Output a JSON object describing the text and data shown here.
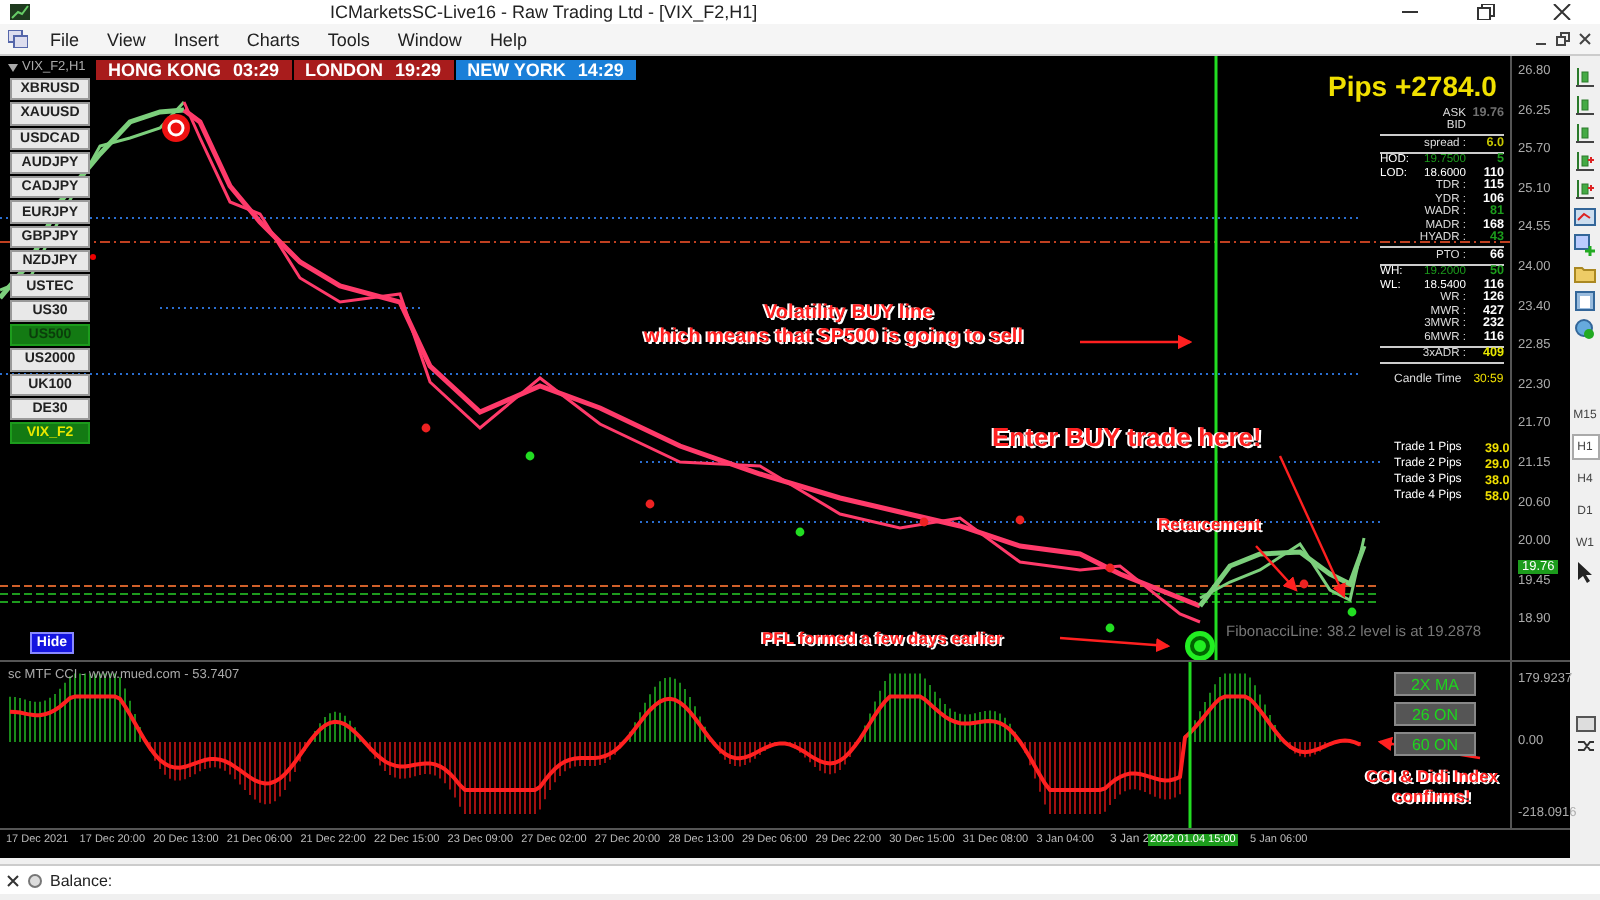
{
  "window": {
    "title": "ICMarketsSC-Live16 - Raw Trading Ltd - [VIX_F2,H1]"
  },
  "menu": [
    "File",
    "View",
    "Insert",
    "Charts",
    "Tools",
    "Window",
    "Help"
  ],
  "chart": {
    "tab": "VIX_F2,H1",
    "sessions": [
      {
        "name": "HONG KONG",
        "time": "03:29",
        "color": "#a81c1c"
      },
      {
        "name": "LONDON",
        "time": "19:29",
        "color": "#a81c1c"
      },
      {
        "name": "NEW YORK",
        "time": "14:29",
        "color": "#1a7fd8"
      }
    ],
    "symbols": [
      {
        "label": "XBRUSD",
        "selected": false,
        "current": false,
        "alert": false
      },
      {
        "label": "XAUUSD",
        "selected": false,
        "current": false,
        "alert": false
      },
      {
        "label": "USDCAD",
        "selected": false,
        "current": false,
        "alert": false
      },
      {
        "label": "AUDJPY",
        "selected": false,
        "current": false,
        "alert": false
      },
      {
        "label": "CADJPY",
        "selected": false,
        "current": false,
        "alert": false
      },
      {
        "label": "EURJPY",
        "selected": false,
        "current": false,
        "alert": false
      },
      {
        "label": "GBPJPY",
        "selected": false,
        "current": false,
        "alert": false
      },
      {
        "label": "NZDJPY",
        "selected": false,
        "current": false,
        "alert": true
      },
      {
        "label": "USTEC",
        "selected": false,
        "current": false,
        "alert": false
      },
      {
        "label": "US30",
        "selected": false,
        "current": false,
        "alert": false
      },
      {
        "label": "US500",
        "selected": true,
        "current": false,
        "alert": false
      },
      {
        "label": "US2000",
        "selected": false,
        "current": false,
        "alert": false
      },
      {
        "label": "UK100",
        "selected": false,
        "current": false,
        "alert": false
      },
      {
        "label": "DE30",
        "selected": false,
        "current": false,
        "alert": false
      },
      {
        "label": "VIX_F2",
        "selected": true,
        "current": true,
        "alert": false
      }
    ],
    "hide_button": "Hide",
    "pips": "Pips +2784.0",
    "stats_groups": [
      [
        {
          "label": "ASK",
          "value": "19.76",
          "color": "#707070"
        },
        {
          "label": "BID"
        }
      ],
      [
        {
          "label": "spread :",
          "value": "6.0",
          "color": "#c8c800"
        }
      ],
      [
        {
          "label": "HOD:",
          "detail": "19.7500",
          "value": "5",
          "color": "#1c9c1c"
        },
        {
          "label": "LOD:",
          "detail": "18.6000",
          "value": "110",
          "color": "#ffffff"
        },
        {
          "label": "TDR :",
          "value": "115",
          "color": "#ffffff"
        },
        {
          "label": "YDR :",
          "value": "106",
          "color": "#ffffff"
        },
        {
          "label": "WADR :",
          "value": "81",
          "color": "#1c9c1c"
        },
        {
          "label": "MADR :",
          "value": "168",
          "color": "#ffffff"
        },
        {
          "label": "HYADR :",
          "value": "43",
          "color": "#1c9c1c"
        }
      ],
      [
        {
          "label": "PTO :",
          "value": "66",
          "color": "#ffffff"
        }
      ],
      [
        {
          "label": "WH:",
          "detail": "19.2000",
          "value": "50",
          "color": "#1c9c1c"
        },
        {
          "label": "WL:",
          "detail": "18.5400",
          "value": "116",
          "color": "#ffffff"
        },
        {
          "label": "WR :",
          "value": "126",
          "color": "#ffffff"
        },
        {
          "label": "MWR :",
          "value": "427",
          "color": "#ffffff"
        },
        {
          "label": "3MWR :",
          "value": "232",
          "color": "#ffffff"
        },
        {
          "label": "6MWR :",
          "value": "116",
          "color": "#ffffff"
        }
      ],
      [
        {
          "label": "3xADR :",
          "value": "409",
          "color": "#e8e800"
        }
      ]
    ],
    "candle_time": {
      "label": "Candle Time",
      "value": "30:59"
    },
    "trades": [
      {
        "label": "Trade 1 Pips",
        "value": "39.0"
      },
      {
        "label": "Trade 2 Pips",
        "value": "29.0"
      },
      {
        "label": "Trade 3 Pips",
        "value": "38.0"
      },
      {
        "label": "Trade 4 Pips",
        "value": "58.0"
      }
    ],
    "volatility_note": [
      "Volatility BUY line",
      "which means that SP500 is going to sell"
    ],
    "entry_note": "Enter BUY trade here!",
    "retracement_note": "Retarcement",
    "pfl_note": "PFL formed a few days earlier",
    "fibonacci_label": "FibonacciLine: 38.2 level is at 19.2878",
    "price_axis": [
      "26.80",
      "26.25",
      "25.70",
      "25.10",
      "24.55",
      "24.00",
      "23.40",
      "22.85",
      "22.30",
      "21.70",
      "21.15",
      "20.60",
      "20.00",
      "19.45",
      "18.90"
    ],
    "current_price": "19.76"
  },
  "indicator": {
    "title": "sc MTF CCI - www.mued.com - 53.7407",
    "buttons": [
      "2X MA",
      "26 ON",
      "60 ON"
    ],
    "axis": [
      "179.9237",
      "0.00",
      "-218.0916"
    ],
    "note": "CCI & Didi Index confirms!"
  },
  "time_axis": {
    "labels": [
      "17 Dec 2021",
      "17 Dec 20:00",
      "20 Dec 13:00",
      "21 Dec 06:00",
      "21 Dec 22:00",
      "22 Dec 15:00",
      "23 Dec 09:00",
      "27 Dec 02:00",
      "27 Dec 20:00",
      "28 Dec 13:00",
      "29 Dec 06:00",
      "29 Dec 22:00",
      "30 Dec 15:00",
      "31 Dec 08:00",
      "3 Jan 04:00",
      "3 Jan 2"
    ],
    "cursor_label": "2022.01.04 15:00",
    "last_label": "5 Jan 06:00"
  },
  "toolbar": {
    "timeframes": [
      {
        "label": "M15",
        "selected": false
      },
      {
        "label": "H1",
        "selected": true
      },
      {
        "label": "H4",
        "selected": false
      },
      {
        "label": "D1",
        "selected": false
      },
      {
        "label": "W1",
        "selected": false
      }
    ]
  },
  "status_bar": {
    "balance_label": "Balance:"
  }
}
